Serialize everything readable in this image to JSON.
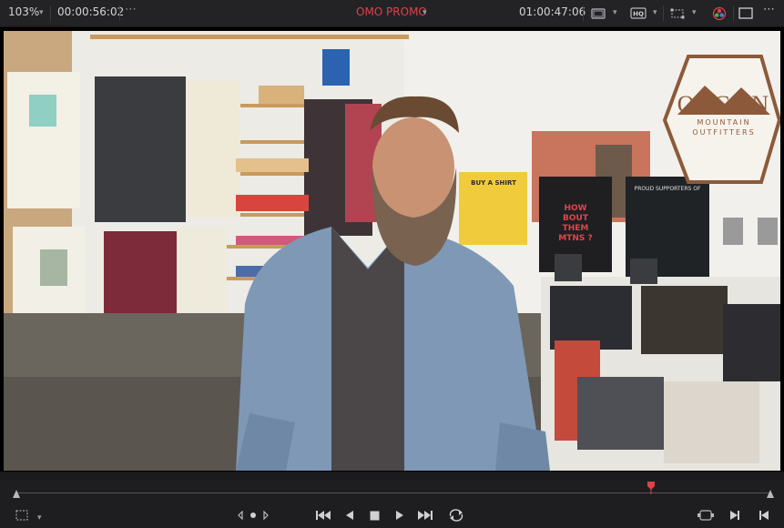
{
  "topbar": {
    "zoom": "103%",
    "source_timecode": "00:00:56:02",
    "clip_title": "OMO PROMO",
    "record_timecode": "01:00:47:06"
  },
  "video": {
    "store_logo_line1": "ORGAN",
    "store_logo_line2": "MOUNTAIN",
    "store_logo_line3": "OUTFITTERS",
    "sign_yellow": "BUY A SHIRT",
    "sign_black": "HOW BOUT THEM MTNS ?",
    "sign_supporters": "PROUD SUPPORTERS OF"
  },
  "icons": {
    "viewer_type": "monitor-icon",
    "hq": "hq-icon",
    "transform": "transform-icon",
    "color": "color-wheels-icon",
    "window": "single-viewer-icon",
    "more": "more-icon"
  },
  "playhead_fraction": 0.842,
  "colors": {
    "accent": "#e0404a",
    "background": "#1b1b1d"
  }
}
